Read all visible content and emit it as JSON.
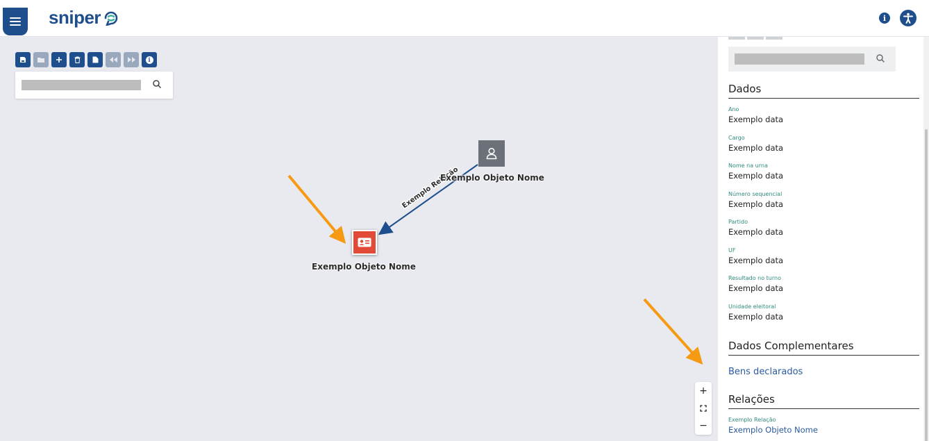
{
  "header": {
    "logo_text": "sniper",
    "menu_icon": "hamburger-icon",
    "info_icon": "info-icon",
    "accessibility_icon": "accessibility-icon"
  },
  "toolbar": {
    "buttons": [
      {
        "icon": "save-icon",
        "enabled": true
      },
      {
        "icon": "folder-open-icon",
        "enabled": false
      },
      {
        "icon": "plus-icon",
        "enabled": true
      },
      {
        "icon": "trash-icon",
        "enabled": true
      },
      {
        "icon": "file-icon",
        "enabled": true
      },
      {
        "icon": "undo-icon",
        "enabled": false
      },
      {
        "icon": "redo-icon",
        "enabled": false
      },
      {
        "icon": "info-icon",
        "enabled": true
      }
    ]
  },
  "graph": {
    "nodes": [
      {
        "id": "person",
        "type": "person",
        "label": "Exemplo Objeto Nome",
        "color": "#6b7079"
      },
      {
        "id": "card",
        "type": "id-card",
        "label": "Exemplo Objeto Nome",
        "color": "#e04a36"
      }
    ],
    "edges": [
      {
        "from": "person",
        "to": "card",
        "label": "Exemplo Relação"
      }
    ],
    "zoom_controls": [
      "+",
      "−"
    ]
  },
  "panel": {
    "dados_title": "Dados",
    "fields": [
      {
        "label": "Ano",
        "value": "Exemplo data"
      },
      {
        "label": "Cargo",
        "value": "Exemplo data"
      },
      {
        "label": "Nome na urna",
        "value": "Exemplo data"
      },
      {
        "label": "Número sequencial",
        "value": "Exemplo data"
      },
      {
        "label": "Partido",
        "value": "Exemplo data"
      },
      {
        "label": "UF",
        "value": "Exemplo data"
      },
      {
        "label": "Resultado no turno",
        "value": "Exemplo data"
      },
      {
        "label": "Unidade eleitoral",
        "value": "Exemplo data"
      }
    ],
    "complementares_title": "Dados Complementares",
    "bens_link": "Bens declarados",
    "relacoes_title": "Relações",
    "relation": {
      "label": "Exemplo Relação",
      "value": "Exemplo Objeto Nome"
    }
  },
  "colors": {
    "brand": "#1f4e8c",
    "accent_teal": "#2f8a7e",
    "canvas_bg": "#e8eaf0",
    "arrow_annotation": "#f59a12"
  }
}
